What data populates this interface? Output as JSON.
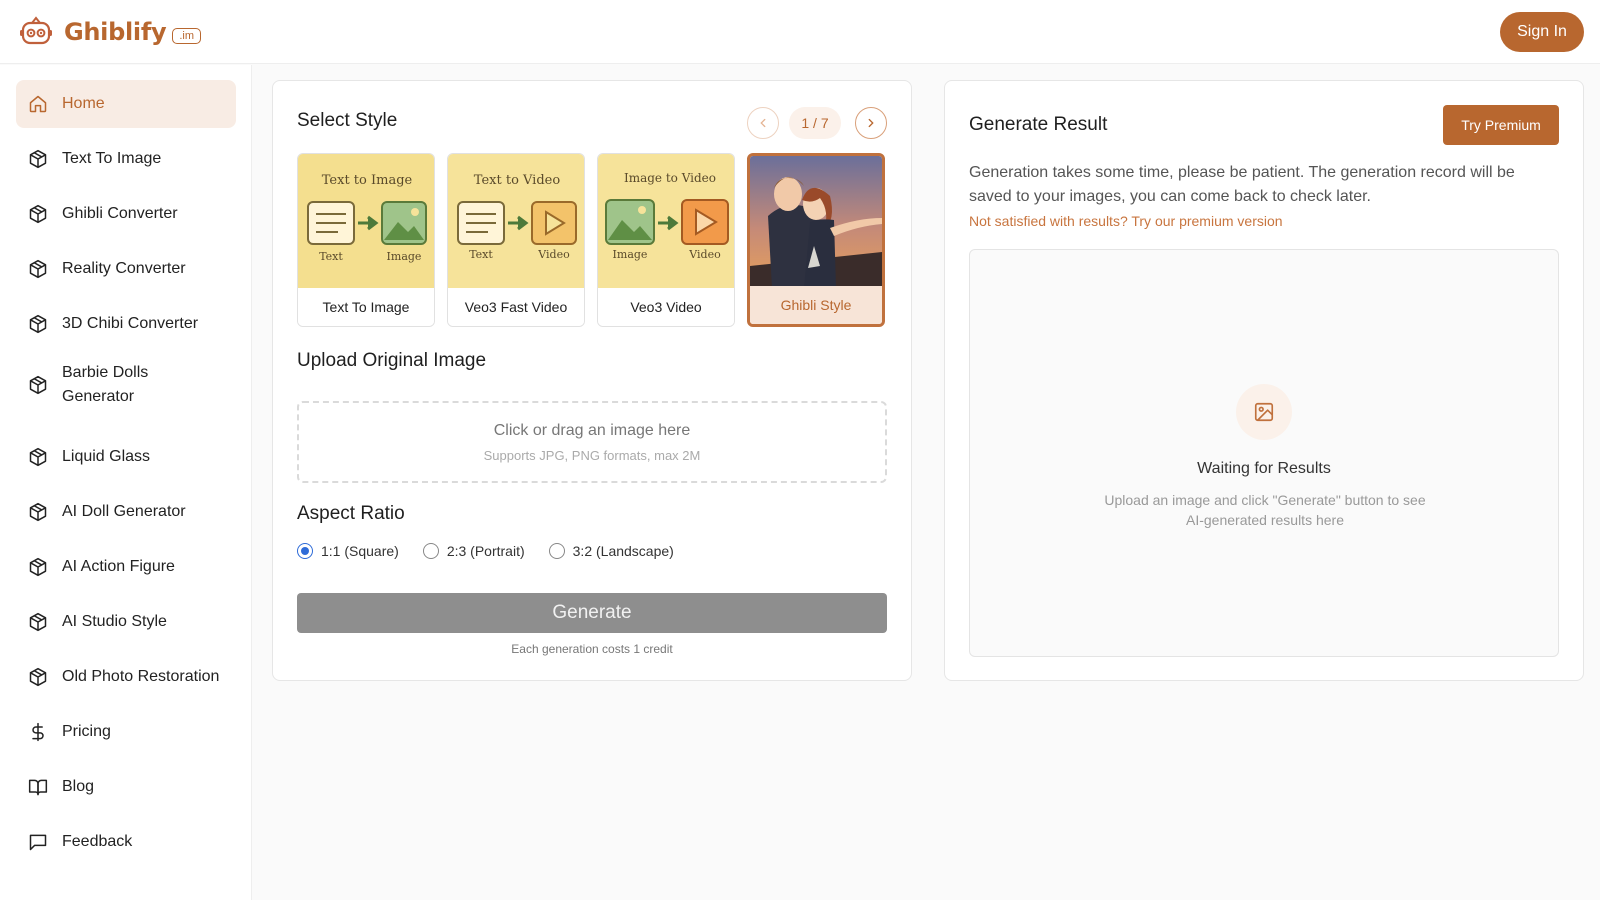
{
  "brand": {
    "name": "Ghiblify",
    "badge": ".im",
    "accent": "#b8672f"
  },
  "header": {
    "sign_in_label": "Sign In"
  },
  "sidebar": {
    "items": [
      {
        "label": "Home",
        "icon": "home-icon",
        "active": true
      },
      {
        "label": "Text To Image",
        "icon": "cube-icon"
      },
      {
        "label": "Ghibli Converter",
        "icon": "cube-icon"
      },
      {
        "label": "Reality Converter",
        "icon": "cube-icon"
      },
      {
        "label": "3D Chibi Converter",
        "icon": "cube-icon"
      },
      {
        "label": "Barbie Dolls Generator",
        "icon": "cube-icon"
      },
      {
        "label": "Liquid Glass",
        "icon": "cube-icon"
      },
      {
        "label": "AI Doll Generator",
        "icon": "cube-icon"
      },
      {
        "label": "AI Action Figure",
        "icon": "cube-icon"
      },
      {
        "label": "AI Studio Style",
        "icon": "cube-icon"
      },
      {
        "label": "Old Photo Restoration",
        "icon": "cube-icon"
      },
      {
        "label": "Pricing",
        "icon": "dollar-icon"
      },
      {
        "label": "Blog",
        "icon": "book-icon"
      },
      {
        "label": "Feedback",
        "icon": "message-icon"
      }
    ]
  },
  "style_select": {
    "title": "Select Style",
    "page": "1 / 7",
    "cards": [
      {
        "label": "Text To Image",
        "thumb_title": "Text to Image",
        "left_caption": "Text",
        "right_caption": "Image"
      },
      {
        "label": "Veo3 Fast Video",
        "thumb_title": "Text to Video",
        "left_caption": "Text",
        "right_caption": "Video"
      },
      {
        "label": "Veo3 Video",
        "thumb_title": "Image to Video",
        "left_caption": "Image",
        "right_caption": "Video"
      },
      {
        "label": "Ghibli Style",
        "selected": true
      }
    ]
  },
  "upload": {
    "title": "Upload Original Image",
    "main_text": "Click or drag an image here",
    "sub_text": "Supports JPG, PNG formats, max 2M"
  },
  "aspect_ratio": {
    "title": "Aspect Ratio",
    "options": [
      "1:1 (Square)",
      "2:3 (Portrait)",
      "3:2 (Landscape)"
    ],
    "selected": "1:1 (Square)"
  },
  "generate": {
    "label": "Generate",
    "cost_note": "Each generation costs 1 credit"
  },
  "result": {
    "title": "Generate Result",
    "premium_label": "Try Premium",
    "description": "Generation takes some time, please be patient. The generation record will be saved to your images, you can come back to check later.",
    "note": "Not satisfied with results? Try our premium version",
    "waiting_title": "Waiting for Results",
    "waiting_desc": "Upload an image and click \"Generate\" button to see AI-generated results here"
  }
}
